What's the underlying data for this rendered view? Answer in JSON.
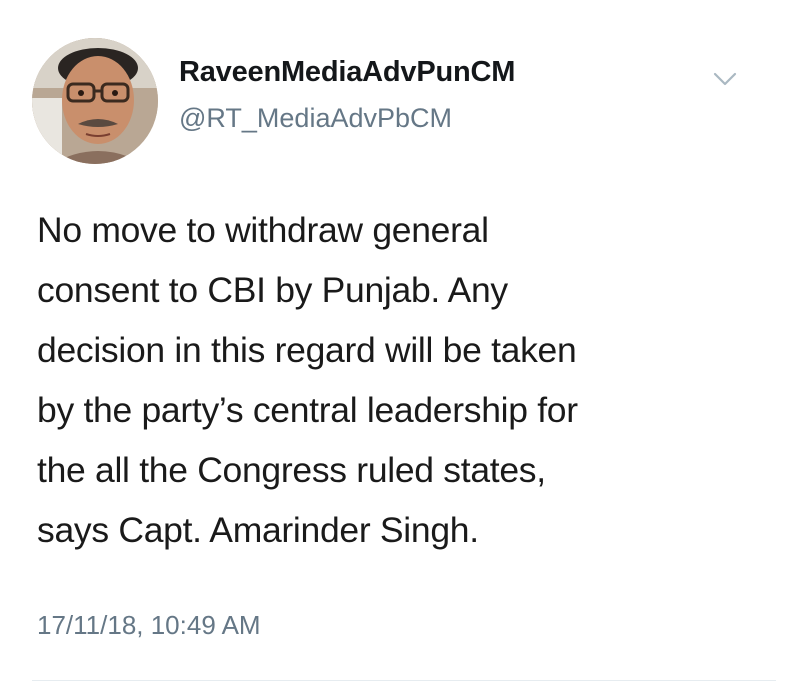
{
  "author": {
    "display_name": "RaveenMediaAdvPunCM",
    "handle": "@RT_MediaAdvPbCM",
    "avatar_icon": "profile-photo",
    "menu_icon": "chevron-down-icon"
  },
  "tweet": {
    "lines": [
      "No move to withdraw general",
      "consent to CBI by Punjab. Any",
      "decision in this regard will be taken",
      "by the party’s central leadership for",
      "the all the Congress ruled states,",
      "says Capt. Amarinder Singh."
    ],
    "timestamp": "17/11/18, 10:49 AM"
  },
  "colors": {
    "name": "#14171a",
    "secondary": "#657786",
    "body_text": "#1a1a1a",
    "divider": "#e6ecf0"
  }
}
